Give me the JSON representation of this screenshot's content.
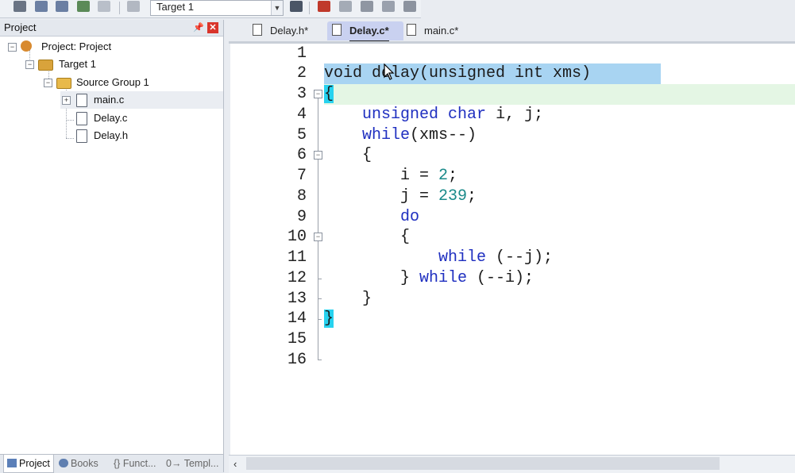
{
  "toolbar": {
    "target_select": "Target 1",
    "icons": [
      "stack-icon",
      "save-icon",
      "load-icon",
      "layers-icon",
      "disabled-icon",
      "load-disabled-icon",
      "magic-wand-icon",
      "component-icon",
      "stack-gray-icon",
      "diamond-icon",
      "arrows-icon",
      "books-gray-icon"
    ]
  },
  "project_panel": {
    "title": "Project",
    "tree": {
      "project": "Project: Project",
      "target": "Target 1",
      "group": "Source Group 1",
      "files": [
        "main.c",
        "Delay.c",
        "Delay.h"
      ]
    }
  },
  "bottom_tabs": [
    "Project",
    "Books",
    "{} Funct...",
    "0→ Templ..."
  ],
  "editor_tabs": [
    "Delay.h*",
    "Delay.c*",
    "main.c*"
  ],
  "active_tab": "Delay.c*",
  "code": {
    "line_numbers": [
      "1",
      "2",
      "3",
      "4",
      "5",
      "6",
      "7",
      "8",
      "9",
      "10",
      "11",
      "12",
      "13",
      "14",
      "15",
      "16"
    ],
    "lines": [
      "",
      "void delay(unsigned int xms)",
      "{",
      "    unsigned char i, j;",
      "    while(xms--)",
      "    {",
      "        i = 2;",
      "        j = 239;",
      "        do",
      "        {",
      "            while (--j);",
      "        } while (--i);",
      "    }",
      "}",
      "",
      ""
    ]
  },
  "colors": {
    "keyword": "#1f2fc0",
    "number": "#1a8a8a",
    "selection": "#a8d4f2",
    "current_line": "#e4f6e4",
    "brace_match": "#27d2ef"
  }
}
